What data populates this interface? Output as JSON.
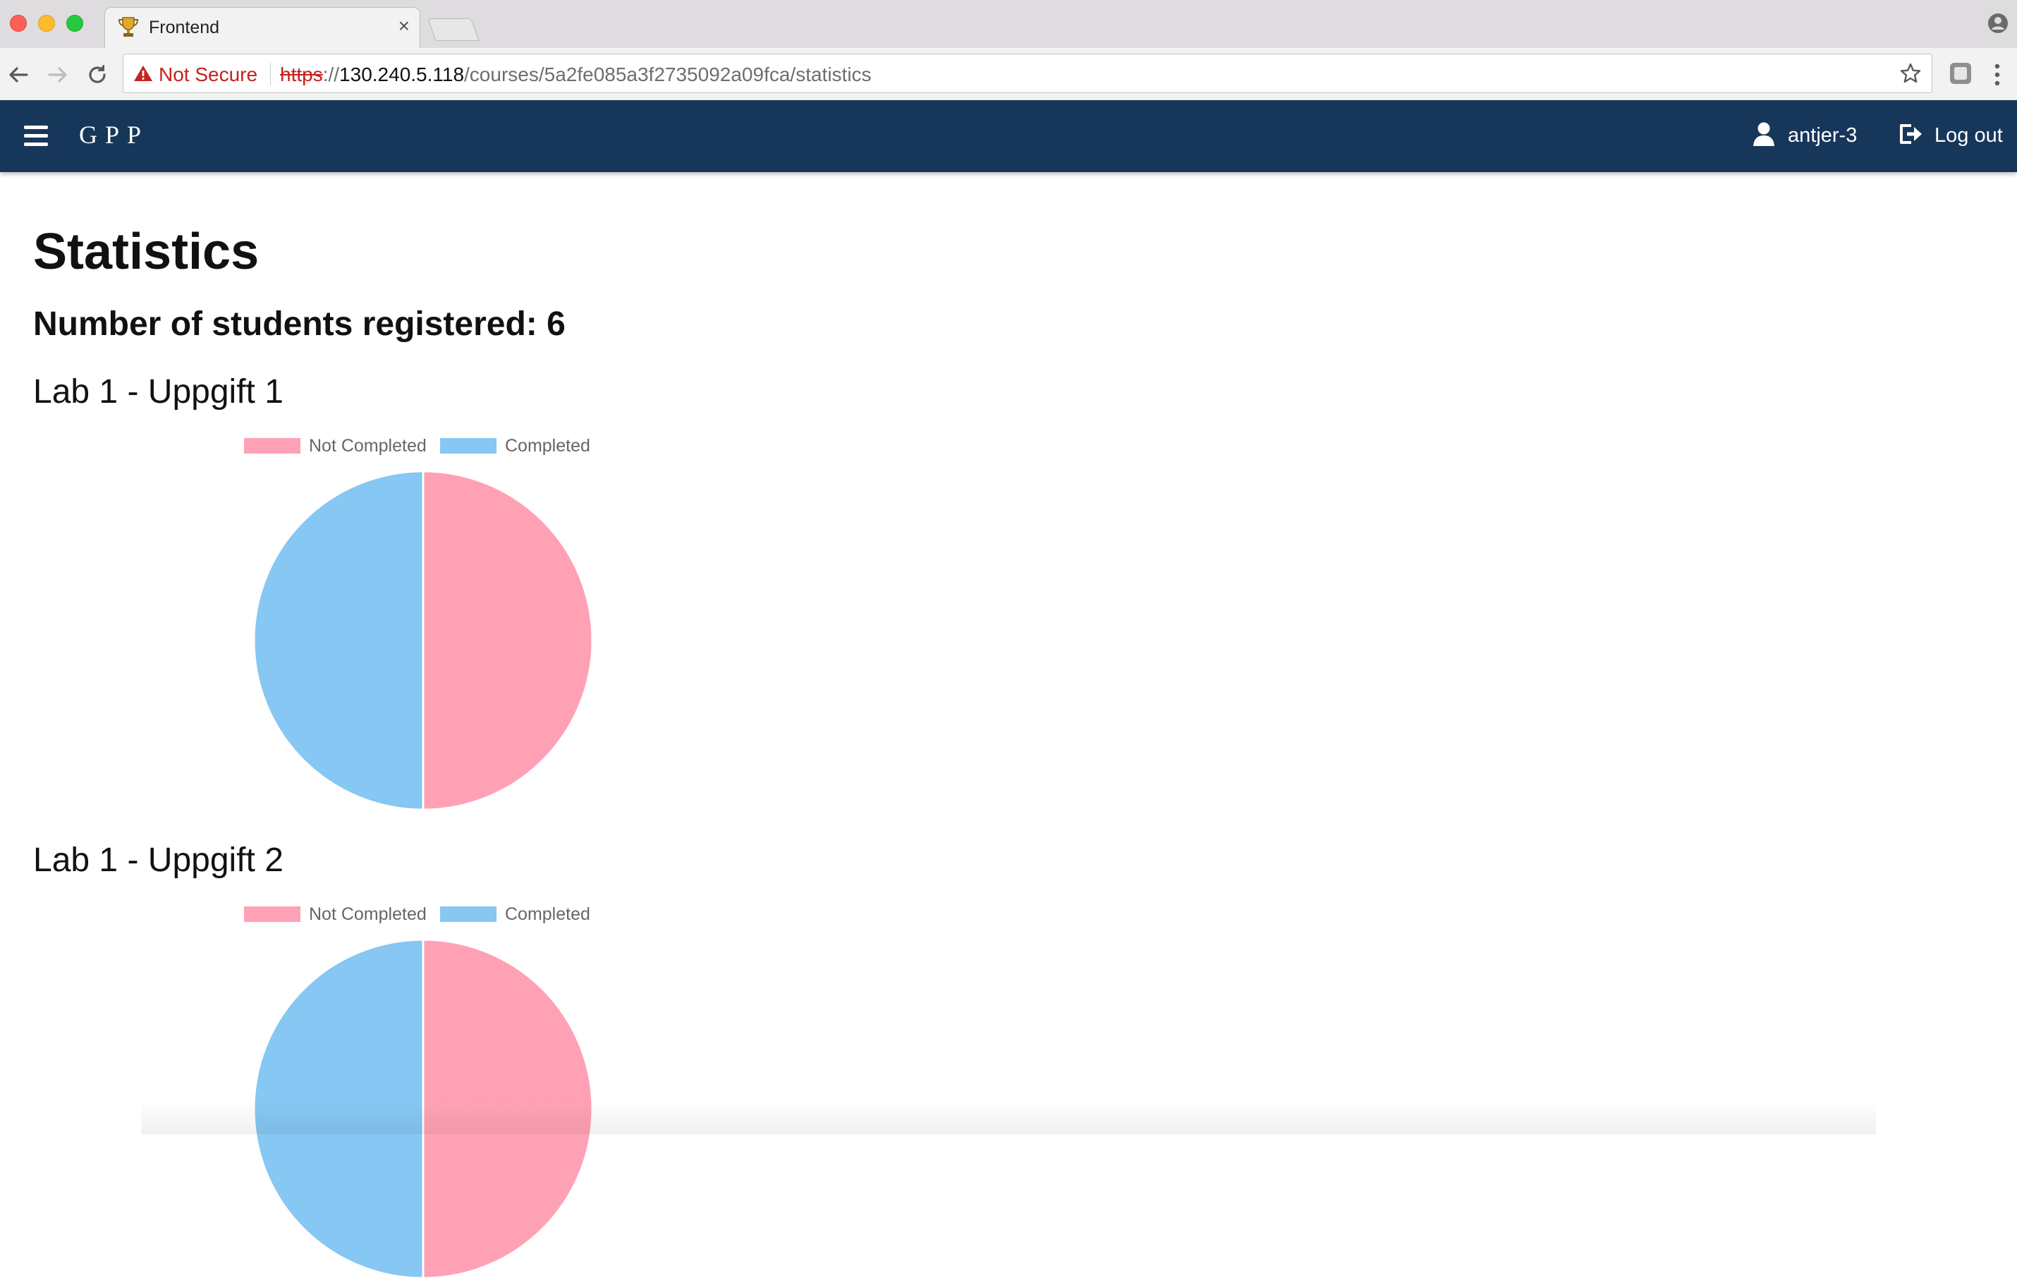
{
  "browser": {
    "tab_title": "Frontend",
    "tab_close": "×",
    "not_secure": "Not Secure",
    "url_scheme": "https",
    "url_sep": "://",
    "url_host": "130.240.5.118",
    "url_path": "/courses/5a2fe085a3f2735092a09fca/statistics"
  },
  "navbar": {
    "brand": "GPP",
    "username": "antjer-3",
    "logout_label": "Log out"
  },
  "page": {
    "title": "Statistics",
    "students_registered": "Number of students registered: 6"
  },
  "colors": {
    "navbar": "#17375a",
    "not_completed": "#ffa1b5",
    "completed": "#86c7f3",
    "warning": "#c5221f"
  },
  "chart_data": [
    {
      "type": "pie",
      "title": "Lab 1 - Uppgift 1",
      "legend": [
        "Not Completed",
        "Completed"
      ],
      "values": [
        3,
        3
      ],
      "colors": [
        "#ffa1b5",
        "#86c7f3"
      ]
    },
    {
      "type": "pie",
      "title": "Lab 1 - Uppgift 2",
      "legend": [
        "Not Completed",
        "Completed"
      ],
      "values": [
        3,
        3
      ],
      "colors": [
        "#ffa1b5",
        "#86c7f3"
      ]
    }
  ]
}
